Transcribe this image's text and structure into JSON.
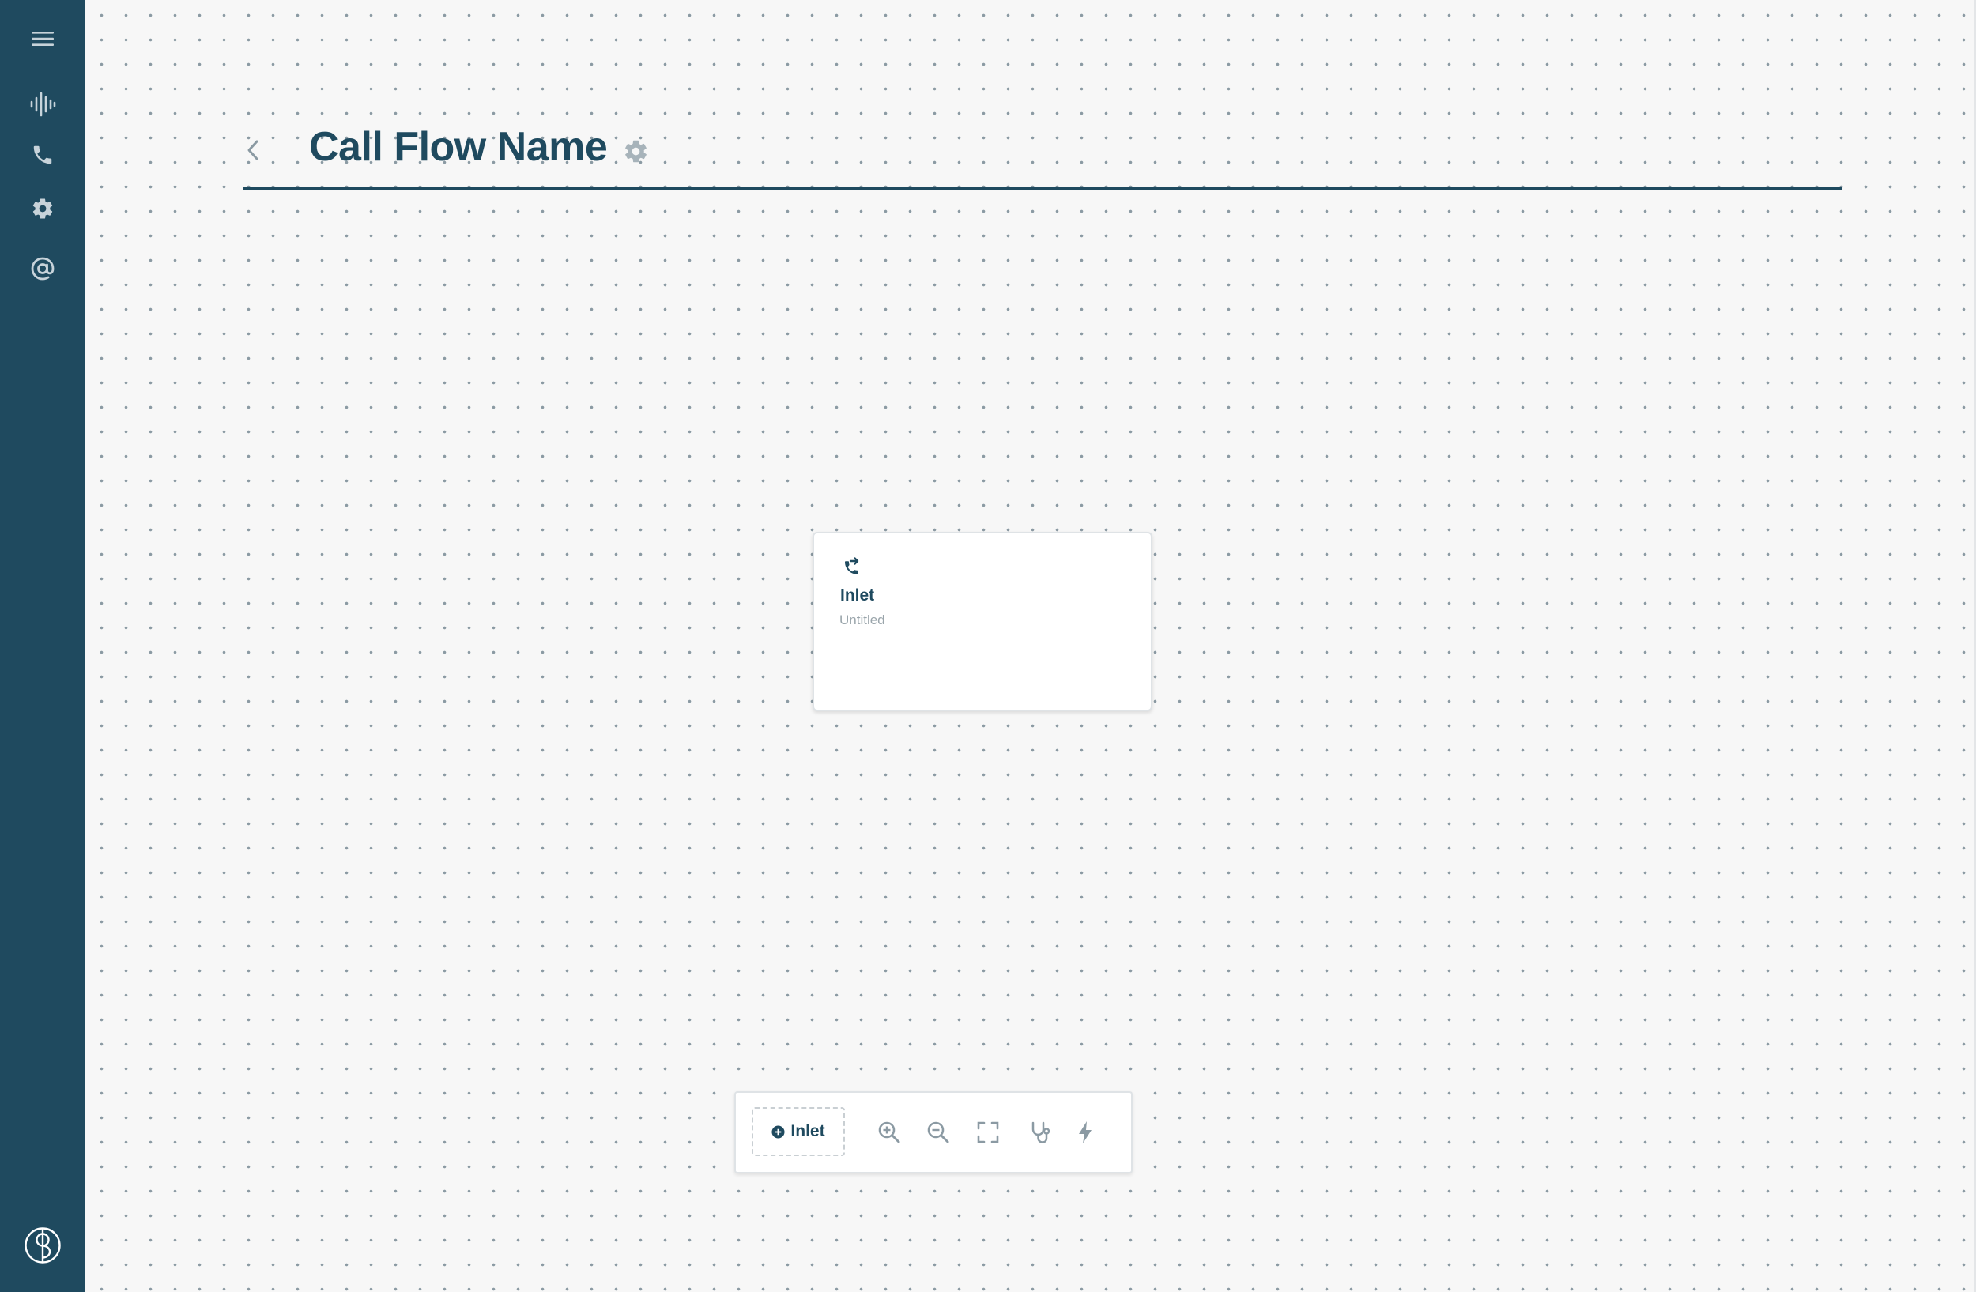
{
  "header": {
    "title": "Call Flow Name"
  },
  "node": {
    "type_label": "Inlet",
    "name": "Untitled"
  },
  "toolbar": {
    "add_label": "Inlet"
  },
  "sidebar": {
    "items": [
      {
        "icon": "menu-icon"
      },
      {
        "icon": "audio-waveform-icon"
      },
      {
        "icon": "phone-icon"
      },
      {
        "icon": "gear-icon"
      },
      {
        "icon": "at-sign-icon"
      },
      {
        "icon": "brand-logo-icon"
      }
    ]
  },
  "icons": {
    "back": "chevron-left-icon",
    "title_settings": "gear-icon",
    "node": "phone-forward-icon",
    "add": "plus-circle-icon",
    "zoom_in": "zoom-in-icon",
    "zoom_out": "zoom-out-icon",
    "fit": "fullscreen-icon",
    "debug": "stethoscope-icon",
    "trigger": "lightning-icon"
  },
  "colors": {
    "primary": "#1f4a5f",
    "canvas": "#f7f7f7",
    "muted": "#9aa5ab",
    "icon_gray": "#8b9aa3"
  }
}
